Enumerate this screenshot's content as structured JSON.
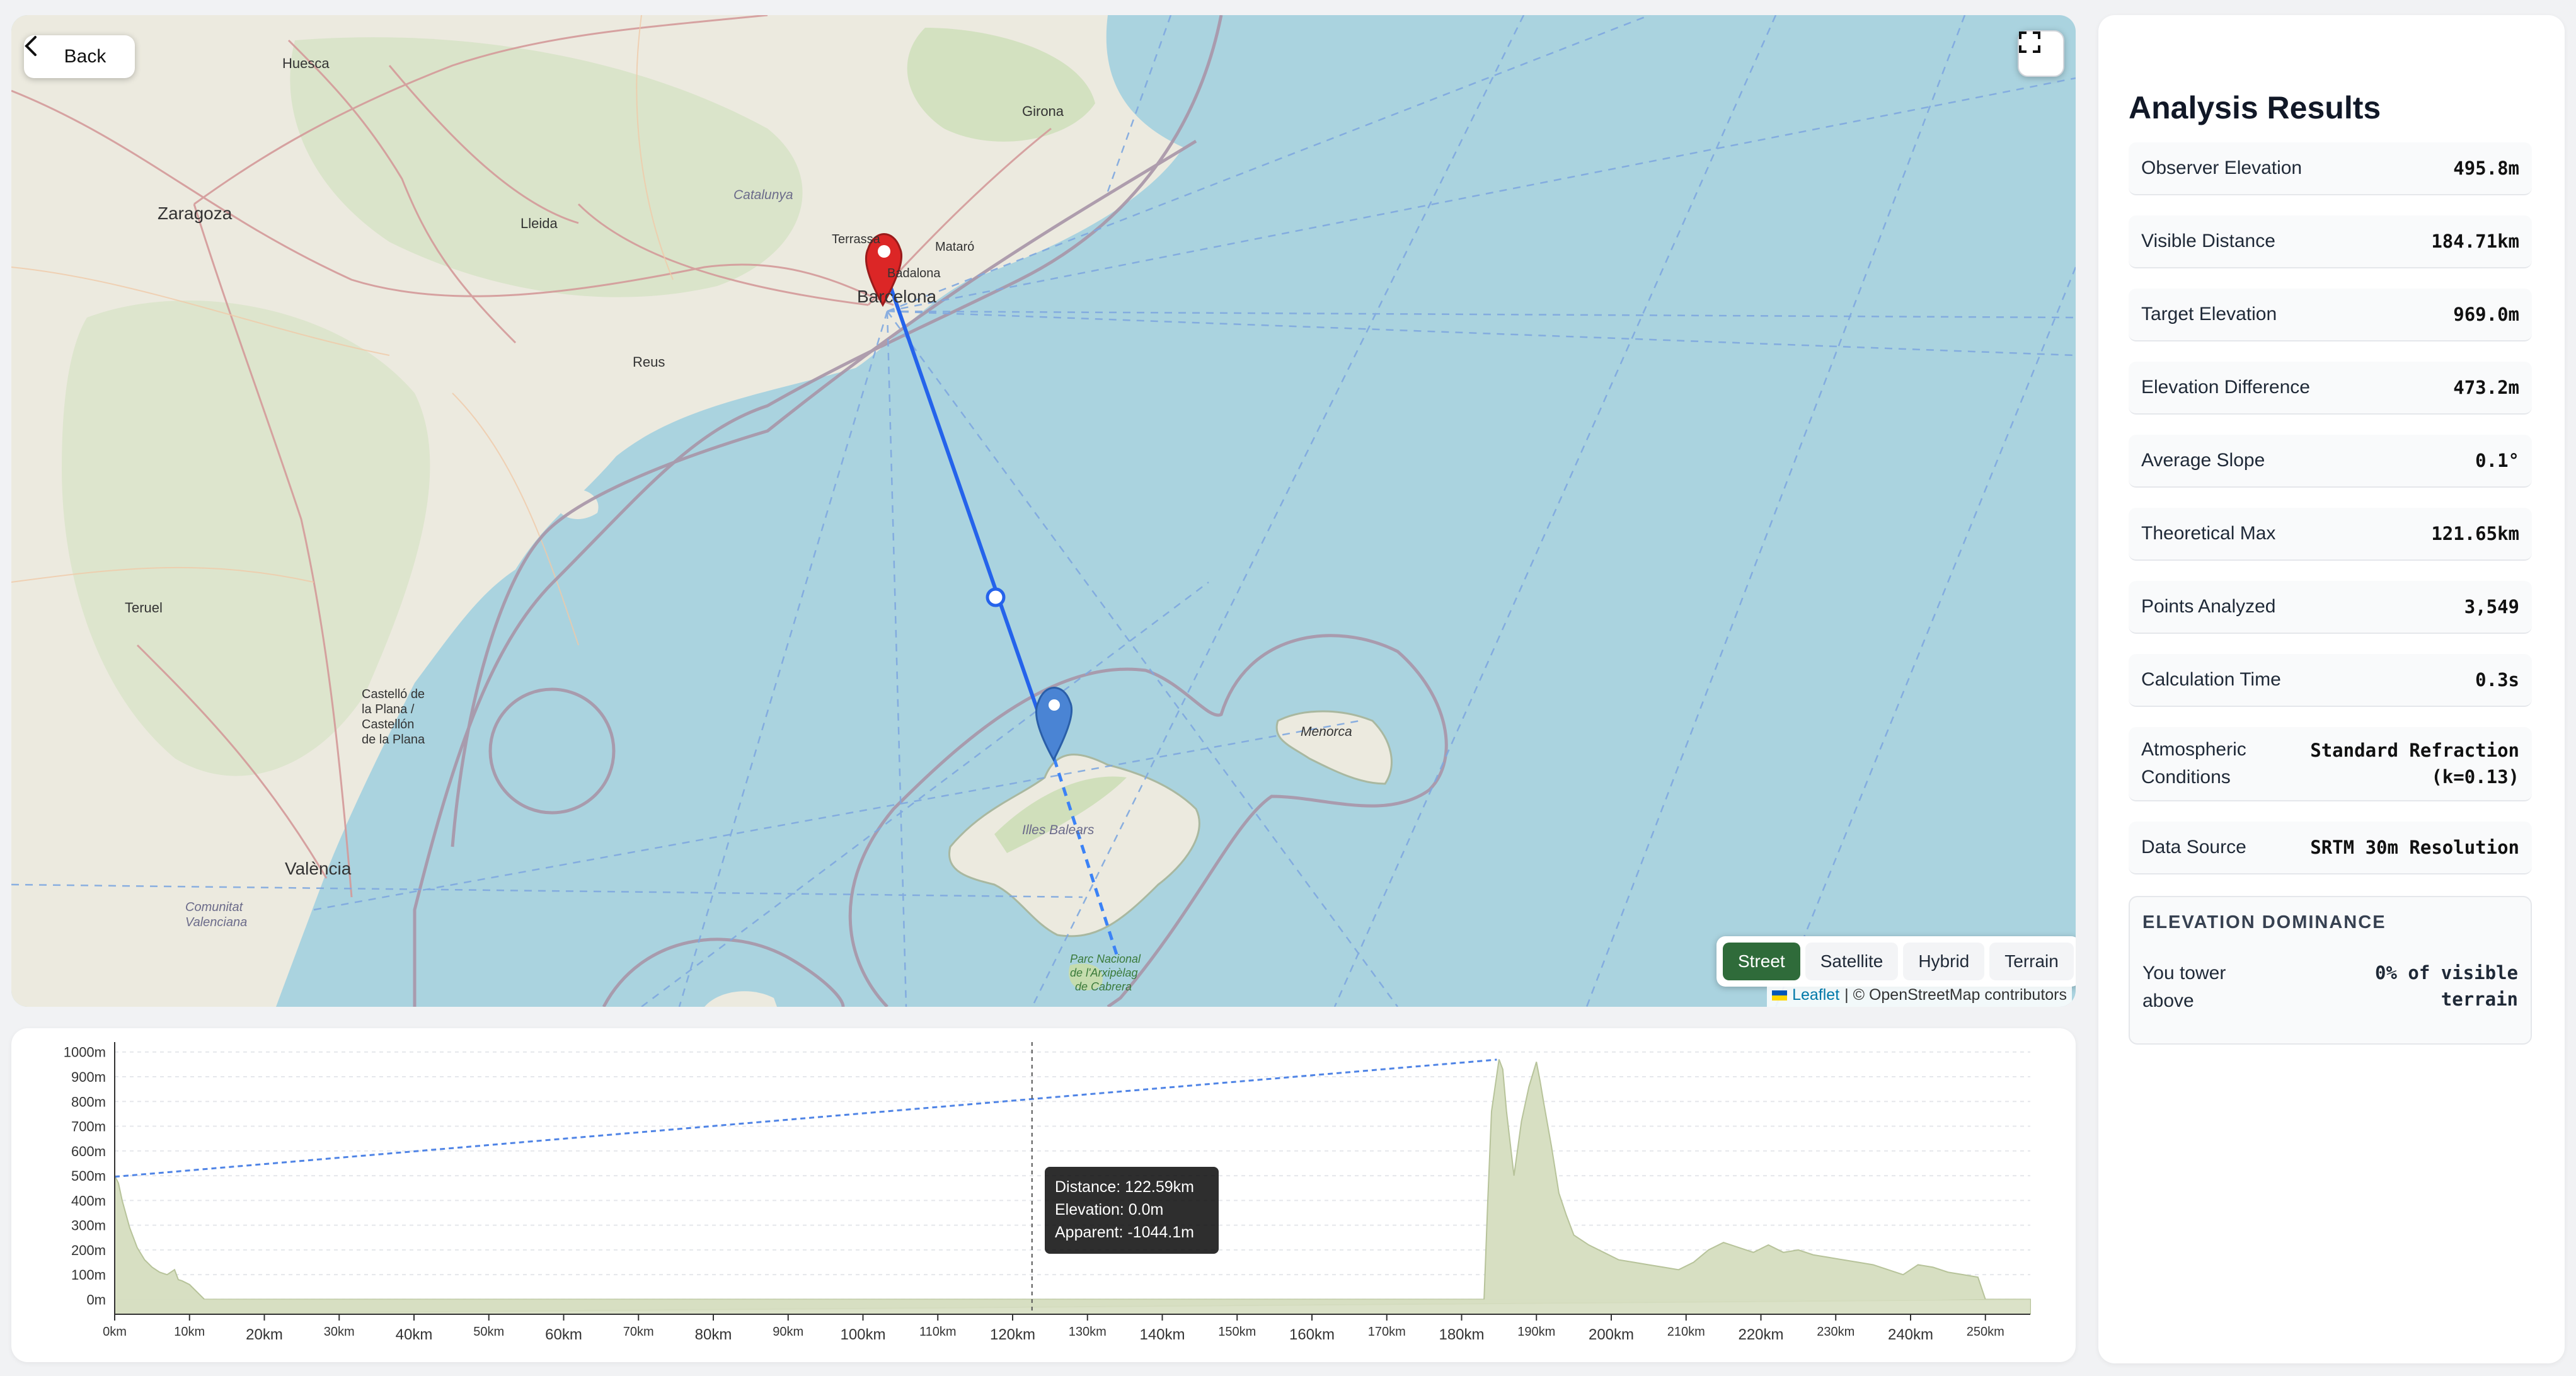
{
  "map": {
    "back_label": "Back",
    "layers": [
      "Street",
      "Satellite",
      "Hybrid",
      "Terrain"
    ],
    "active_layer": "Street",
    "attribution_leaflet": "Leaflet",
    "attribution_rest": "| © OpenStreetMap contributors",
    "places": {
      "huesca": "Huesca",
      "zaragoza": "Zaragoza",
      "girona": "Girona",
      "lleida": "Lleida",
      "catalunya": "Catalunya",
      "terrassa": "Terrassa",
      "mataro": "Mataró",
      "badalona": "Badalona",
      "barcelona": "Barcelona",
      "reus": "Reus",
      "teruel": "Teruel",
      "castello_1": "Castelló de",
      "castello_2": "la Plana /",
      "castello_3": "Castellón",
      "castello_4": "de la Plana",
      "valencia": "València",
      "comunitat_1": "Comunitat",
      "comunitat_2": "Valenciana",
      "menorca": "Menorca",
      "illes": "Illes Balears",
      "parc_1": "Parc Nacional",
      "parc_2": "de l'Arxipèlag",
      "parc_3": "de Cabrera"
    }
  },
  "analysis": {
    "title": "Analysis Results",
    "stats": [
      {
        "label": "Observer Elevation",
        "value": "495.8m"
      },
      {
        "label": "Visible Distance",
        "value": "184.71km"
      },
      {
        "label": "Target Elevation",
        "value": "969.0m"
      },
      {
        "label": "Elevation Difference",
        "value": "473.2m"
      },
      {
        "label": "Average Slope",
        "value": "0.1°"
      },
      {
        "label": "Theoretical Max",
        "value": "121.65km"
      },
      {
        "label": "Points Analyzed",
        "value": "3,549"
      },
      {
        "label": "Calculation Time",
        "value": "0.3s"
      },
      {
        "label": "Atmospheric Conditions",
        "value_line1": "Standard Refraction",
        "value_line2": "(k=0.13)"
      },
      {
        "label": "Data Source",
        "value": "SRTM 30m Resolution"
      }
    ],
    "dominance": {
      "title": "ELEVATION DOMINANCE",
      "label_line1": "You tower",
      "label_line2": "above",
      "value_line1": "0% of visible",
      "value_line2": "terrain"
    }
  },
  "tooltip": {
    "distance": "Distance: 122.59km",
    "elevation": "Elevation: 0.0m",
    "apparent": "Apparent: -1044.1m"
  },
  "chart_data": {
    "type": "area",
    "xlabel": "",
    "ylabel": "",
    "xlim": [
      0,
      256
    ],
    "ylim": [
      -60,
      1040
    ],
    "grid": true,
    "x_ticks": [
      "0km",
      "10km",
      "20km",
      "30km",
      "40km",
      "50km",
      "60km",
      "70km",
      "80km",
      "90km",
      "100km",
      "110km",
      "120km",
      "130km",
      "140km",
      "150km",
      "160km",
      "170km",
      "180km",
      "190km",
      "200km",
      "210km",
      "220km",
      "230km",
      "240km",
      "250km"
    ],
    "y_ticks": [
      "0m",
      "100m",
      "200m",
      "300m",
      "400m",
      "500m",
      "600m",
      "700m",
      "800m",
      "900m",
      "1000m"
    ],
    "series": [
      {
        "kind": "terrain-area",
        "x": [
          0,
          0.5,
          1,
          2,
          3,
          4,
          5,
          6,
          7,
          8,
          8.5,
          9,
          10,
          12,
          183,
          183.5,
          184,
          185,
          185.5,
          186,
          187,
          188,
          189,
          190,
          190.5,
          191,
          192,
          193,
          194,
          195,
          197,
          199,
          201,
          203,
          205,
          207,
          209,
          211,
          213,
          215,
          217,
          219,
          221,
          223,
          225,
          227,
          229,
          231,
          233,
          235,
          237,
          239,
          241,
          243,
          245,
          247,
          249,
          250,
          256
        ],
        "y": [
          500,
          470,
          400,
          290,
          210,
          160,
          130,
          110,
          100,
          120,
          80,
          75,
          60,
          0,
          0,
          400,
          760,
          970,
          930,
          760,
          500,
          720,
          860,
          960,
          880,
          790,
          620,
          430,
          340,
          260,
          220,
          190,
          160,
          150,
          140,
          130,
          120,
          150,
          200,
          230,
          210,
          190,
          220,
          190,
          200,
          180,
          170,
          160,
          150,
          140,
          120,
          100,
          140,
          130,
          110,
          100,
          90,
          0,
          0
        ]
      },
      {
        "kind": "line-of-sight",
        "x": [
          0,
          184.71
        ],
        "y": [
          495.8,
          969.0
        ]
      }
    ],
    "cursor_x": 122.59
  }
}
